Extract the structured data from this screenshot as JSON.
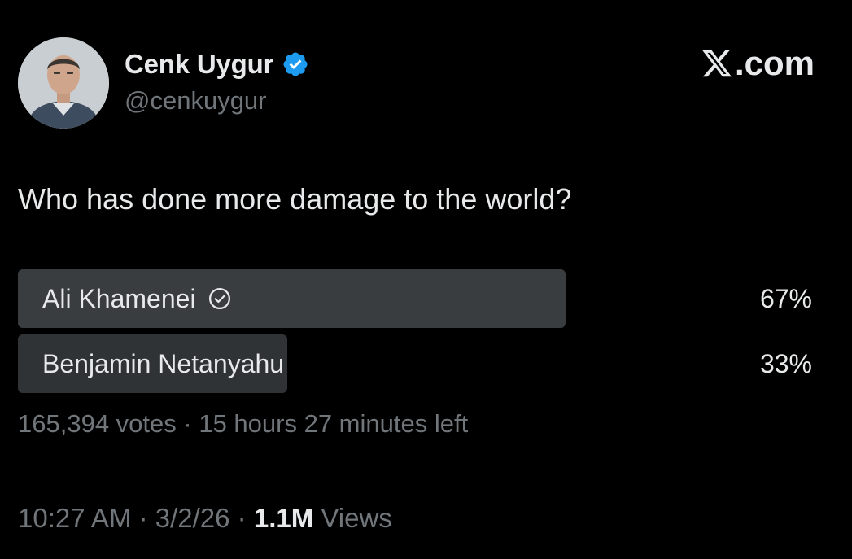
{
  "author": {
    "display_name": "Cenk Uygur",
    "handle": "@cenkuygur",
    "verified": true,
    "avatar_icon": "profile-photo"
  },
  "brand": {
    "icon": "x-logo-icon",
    "label": ".com"
  },
  "tweet": {
    "text": "Who has done more damage to the world?"
  },
  "poll": {
    "options": [
      {
        "label": "Ali Khamenei",
        "percent": "67%",
        "share": 0.67,
        "selected": true
      },
      {
        "label": "Benjamin Netanyahu",
        "percent": "33%",
        "share": 0.33,
        "selected": false
      }
    ],
    "votes": "165,394 votes",
    "separator": " · ",
    "time_left": "15 hours 27 minutes left"
  },
  "meta": {
    "time": "10:27 AM",
    "date": "3/2/26",
    "separator": " · ",
    "views_count": "1.1M",
    "views_label": "Views"
  },
  "colors": {
    "background": "#000000",
    "text_primary": "#e7e9ea",
    "text_secondary": "#71767b",
    "verified_blue": "#1d9bf0",
    "poll_winner_bar": "#3a3d40",
    "poll_loser_bar": "#2f3336"
  }
}
